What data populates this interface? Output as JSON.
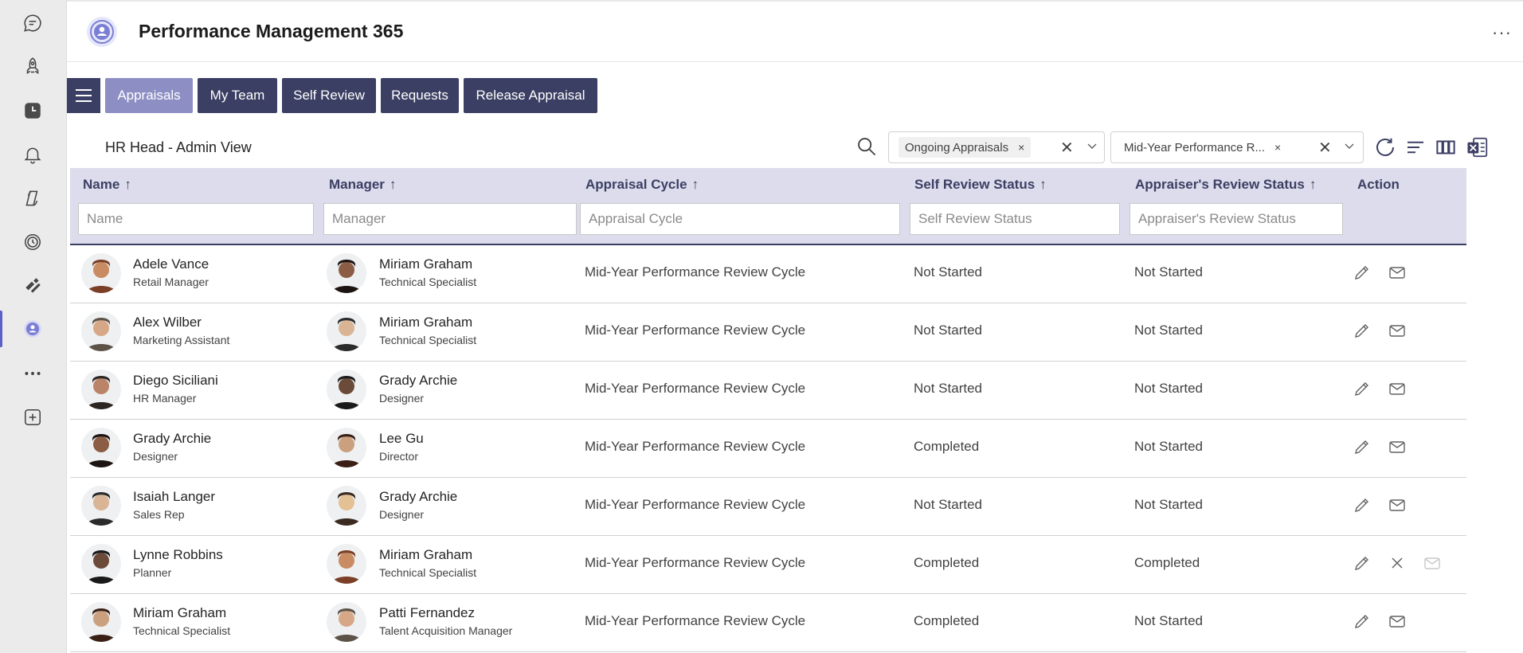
{
  "app": {
    "title": "Performance Management 365",
    "more": "···"
  },
  "rail": [
    {
      "icon": "chat-icon"
    },
    {
      "icon": "rocket-icon"
    },
    {
      "icon": "clock-icon"
    },
    {
      "icon": "bell-icon"
    },
    {
      "icon": "copilot-icon"
    },
    {
      "icon": "timer-icon"
    },
    {
      "icon": "ribbon-icon"
    },
    {
      "icon": "performance-app-icon"
    },
    {
      "icon": "more-apps-icon"
    },
    {
      "icon": "add-app-icon"
    }
  ],
  "nav": {
    "tabs": [
      {
        "label": "Appraisals",
        "active": true
      },
      {
        "label": "My Team",
        "active": false
      },
      {
        "label": "Self Review",
        "active": false
      },
      {
        "label": "Requests",
        "active": false
      },
      {
        "label": "Release Appraisal",
        "active": false
      }
    ]
  },
  "view_label": "HR Head - Admin View",
  "filters": {
    "status_chip": "Ongoing Appraisals",
    "cycle_chip": "Mid-Year Performance R...",
    "chip_remove": "×",
    "clear": "✕",
    "chevron": "⌵"
  },
  "columns": [
    {
      "label": "Name",
      "placeholder": "Name"
    },
    {
      "label": "Manager",
      "placeholder": "Manager"
    },
    {
      "label": "Appraisal Cycle",
      "placeholder": "Appraisal Cycle"
    },
    {
      "label": "Self Review Status",
      "placeholder": "Self Review Status"
    },
    {
      "label": "Appraiser's Review Status",
      "placeholder": "Appraiser's Review Status"
    },
    {
      "label": "Action"
    }
  ],
  "sort_arrow": "↑",
  "rows": [
    {
      "name": "Adele Vance",
      "role": "Retail Manager",
      "manager": "Miriam Graham",
      "manager_role": "Technical Specialist",
      "cycle": "Mid-Year Performance Review Cycle",
      "self": "Not Started",
      "appraiser": "Not Started",
      "actions": [
        "edit",
        "mail"
      ]
    },
    {
      "name": "Alex Wilber",
      "role": "Marketing Assistant",
      "manager": "Miriam Graham",
      "manager_role": "Technical Specialist",
      "cycle": "Mid-Year Performance Review Cycle",
      "self": "Not Started",
      "appraiser": "Not Started",
      "actions": [
        "edit",
        "mail"
      ]
    },
    {
      "name": "Diego Siciliani",
      "role": "HR Manager",
      "manager": "Grady Archie",
      "manager_role": "Designer",
      "cycle": "Mid-Year Performance Review Cycle",
      "self": "Not Started",
      "appraiser": "Not Started",
      "actions": [
        "edit",
        "mail"
      ]
    },
    {
      "name": "Grady Archie",
      "role": "Designer",
      "manager": "Lee Gu",
      "manager_role": "Director",
      "cycle": "Mid-Year Performance Review Cycle",
      "self": "Completed",
      "appraiser": "Not Started",
      "actions": [
        "edit",
        "mail"
      ]
    },
    {
      "name": "Isaiah Langer",
      "role": "Sales Rep",
      "manager": "Grady Archie",
      "manager_role": "Designer",
      "cycle": "Mid-Year Performance Review Cycle",
      "self": "Not Started",
      "appraiser": "Not Started",
      "actions": [
        "edit",
        "mail"
      ]
    },
    {
      "name": "Lynne Robbins",
      "role": "Planner",
      "manager": "Miriam Graham",
      "manager_role": "Technical Specialist",
      "cycle": "Mid-Year Performance Review Cycle",
      "self": "Completed",
      "appraiser": "Completed",
      "actions": [
        "edit",
        "close",
        "mail-disabled"
      ]
    },
    {
      "name": "Miriam Graham",
      "role": "Technical Specialist",
      "manager": "Patti Fernandez",
      "manager_role": "Talent Acquisition Manager",
      "cycle": "Mid-Year Performance Review Cycle",
      "self": "Completed",
      "appraiser": "Not Started",
      "actions": [
        "edit",
        "mail"
      ]
    }
  ],
  "colors": {
    "nav": "#3b3f63",
    "nav_active": "#8d8fc4",
    "header_bg": "#dcdcec",
    "accent": "#5b5fc7"
  }
}
